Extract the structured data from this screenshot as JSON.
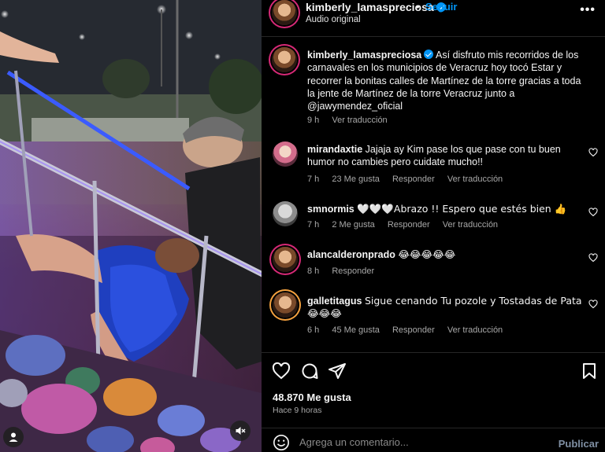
{
  "post": {
    "username": "kimberly_lamaspreciosa",
    "audio": "Audio original",
    "follow_label": "Seguir",
    "separator": "•",
    "more_label": "•••"
  },
  "caption": {
    "username": "kimberly_lamaspreciosa",
    "text": "Así disfruto mis recorridos de los carnavales en los municipios de Veracruz hoy tocó Estar y recorrer la bonitas calles de Martínez de la torre gracias a toda la jente de Martínez de la torre Veracruz junto a @jawymendez_oficial",
    "time": "9 h",
    "translate": "Ver traducción"
  },
  "comments": [
    {
      "username": "mirandaxtie",
      "text": "Jajaja ay Kim pase los que pase con tu buen humor no cambies pero cuidate mucho!!",
      "time": "7 h",
      "likes": "23 Me gusta",
      "reply": "Responder",
      "translate": "Ver traducción"
    },
    {
      "username": "smnormis",
      "text": "🤍🤍🤍Abrazo !! Espero que estés bien 👍",
      "time": "7 h",
      "likes": "2 Me gusta",
      "reply": "Responder",
      "translate": "Ver traducción"
    },
    {
      "username": "alancalderonprado",
      "text": "😂😂😂😂😂",
      "time": "8 h",
      "reply": "Responder"
    },
    {
      "username": "galletitagus",
      "text": "Sigue cenando Tu pozole y Tostadas de Pata 😂😂😂",
      "time": "6 h",
      "likes": "45 Me gusta",
      "reply": "Responder",
      "translate": "Ver traducción"
    }
  ],
  "stats": {
    "likes": "48.870 Me gusta",
    "time": "Hace 9 horas"
  },
  "composer": {
    "placeholder": "Agrega un comentario...",
    "post_label": "Publicar"
  },
  "colors": {
    "accent": "#0095f6",
    "muted": "#a8a8a8",
    "background": "#000000"
  }
}
